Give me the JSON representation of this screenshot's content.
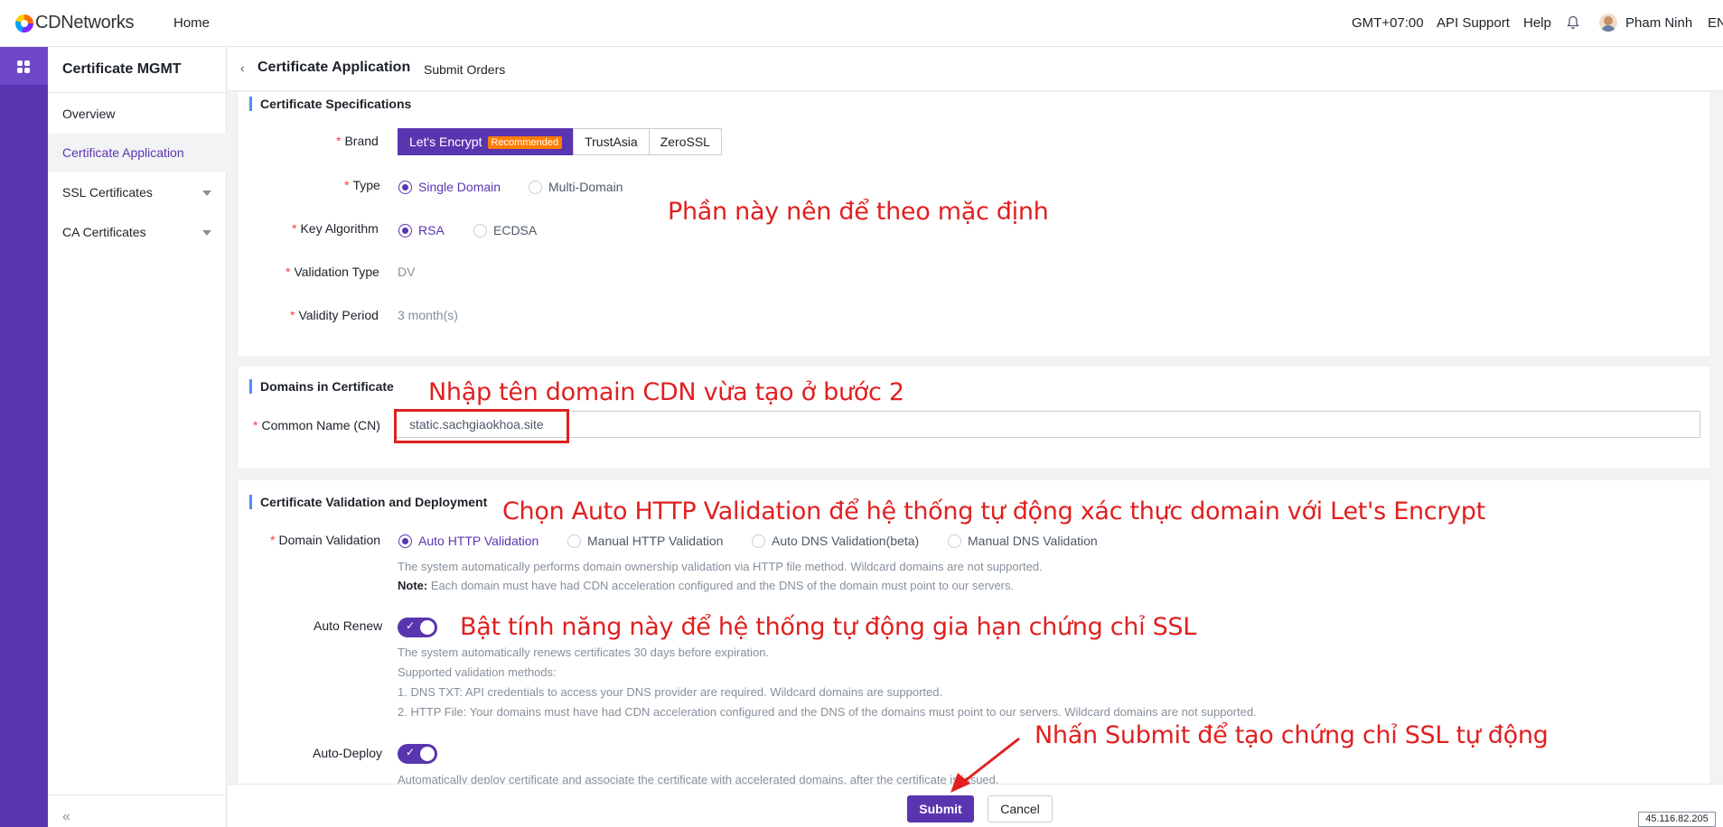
{
  "topbar": {
    "logo": "CDNetworks",
    "home": "Home",
    "timezone": "GMT+07:00",
    "api_support": "API Support",
    "help": "Help",
    "user": "Pham Ninh",
    "lang": "EN"
  },
  "sidebar": {
    "title": "Certificate MGMT",
    "items": [
      {
        "label": "Overview"
      },
      {
        "label": "Certificate Application"
      },
      {
        "label": "SSL Certificates"
      },
      {
        "label": "CA Certificates"
      }
    ],
    "collapse": "«"
  },
  "header": {
    "back": "‹",
    "title": "Certificate Application",
    "subtitle": "Submit Orders"
  },
  "specs": {
    "title": "Certificate Specifications",
    "brand_label": "Brand",
    "brands": [
      "Let's Encrypt",
      "TrustAsia",
      "ZeroSSL"
    ],
    "recommended": "Recommended",
    "type_label": "Type",
    "type_options": [
      "Single Domain",
      "Multi-Domain"
    ],
    "key_label": "Key Algorithm",
    "key_options": [
      "RSA",
      "ECDSA"
    ],
    "validation_type_label": "Validation Type",
    "validation_type_value": "DV",
    "validity_label": "Validity Period",
    "validity_value": "3 month(s)"
  },
  "domains": {
    "title": "Domains in Certificate",
    "cn_label": "Common Name (CN)",
    "cn_value": "static.sachgiaokhoa.site"
  },
  "deploy": {
    "title": "Certificate Validation and Deployment",
    "domain_validation_label": "Domain Validation",
    "validation_options": [
      "Auto HTTP Validation",
      "Manual HTTP Validation",
      "Auto DNS Validation(beta)",
      "Manual DNS Validation"
    ],
    "validation_hint": "The system automatically performs domain ownership validation via HTTP file method. Wildcard domains are not supported.",
    "note_label": "Note:",
    "note_text": " Each domain must have had CDN acceleration configured and the DNS of the domain must point to our servers.",
    "auto_renew_label": "Auto Renew",
    "renew_hints": [
      "The system automatically renews certificates 30 days before expiration.",
      "Supported validation methods:",
      "1. DNS TXT: API credentials to access your DNS provider are required. Wildcard domains are supported.",
      "2. HTTP File: Your domains must have had CDN acceleration configured and the DNS of the domains must point to our servers. Wildcard domains are not supported."
    ],
    "auto_deploy_label": "Auto-Deploy",
    "deploy_hint": "Automatically deploy certificate and associate the certificate with accelerated domains, after the certificate is issued."
  },
  "footer": {
    "submit": "Submit",
    "cancel": "Cancel",
    "ip": "45.116.82.205"
  },
  "annotations": {
    "a1": "Phần này nên để theo mặc định",
    "a2": "Nhập tên domain CDN vừa tạo ở bước 2",
    "a3": "Chọn Auto HTTP Validation để hệ thống tự động xác thực domain với Let's Encrypt",
    "a4": "Bật tính năng này để hệ thống tự động gia hạn chứng chỉ SSL",
    "a5": "Nhấn Submit để tạo chứng chỉ SSL tự động"
  },
  "colors": {
    "primary": "#5a35b0",
    "annotation": "#e02020",
    "recommended": "#ff7d00"
  }
}
